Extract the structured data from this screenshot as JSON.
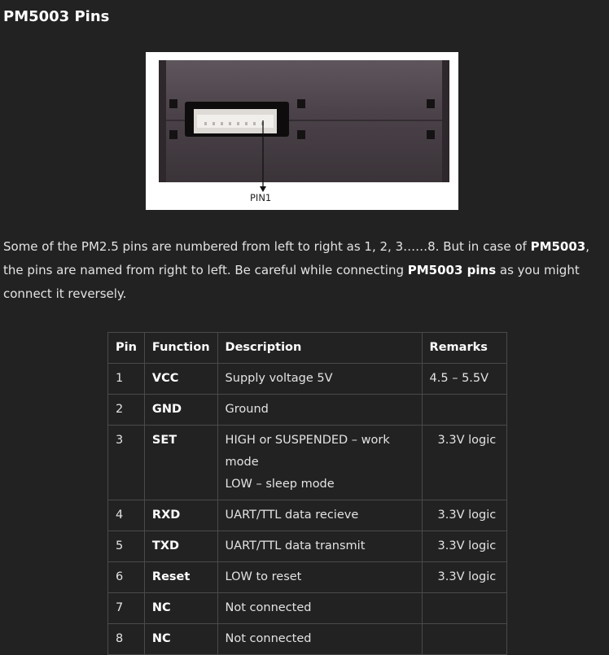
{
  "heading": "PM5003 Pins",
  "figure": {
    "pin_label": "PIN1"
  },
  "paragraph": {
    "t1": "Some of the PM2.5 pins are numbered from left to right as 1, 2, 3……8. But in case of ",
    "b1": "PM5003",
    "t2": ", the pins are named from right to left. Be careful while connecting ",
    "b2": "PM5003 pins",
    "t3": " as you might connect it reversely."
  },
  "table": {
    "headers": [
      "Pin",
      "Function",
      "Description",
      "Remarks"
    ],
    "rows": [
      {
        "pin": "1",
        "function": "VCC",
        "desc1": "Supply voltage 5V",
        "desc2": "",
        "remarks": "4.5 – 5.5V"
      },
      {
        "pin": "2",
        "function": "GND",
        "desc1": "Ground",
        "desc2": "",
        "remarks": ""
      },
      {
        "pin": "3",
        "function": "SET",
        "desc1": "HIGH or SUSPENDED – work mode",
        "desc2": "LOW – sleep mode",
        "remarks": "3.3V logic"
      },
      {
        "pin": "4",
        "function": "RXD",
        "desc1": "UART/TTL data recieve",
        "desc2": "",
        "remarks": "3.3V logic"
      },
      {
        "pin": "5",
        "function": "TXD",
        "desc1": "UART/TTL data transmit",
        "desc2": "",
        "remarks": "3.3V logic"
      },
      {
        "pin": "6",
        "function": "Reset",
        "desc1": "LOW to reset",
        "desc2": "",
        "remarks": "3.3V logic"
      },
      {
        "pin": "7",
        "function": "NC",
        "desc1": "Not connected",
        "desc2": "",
        "remarks": ""
      },
      {
        "pin": "8",
        "function": "NC",
        "desc1": "Not connected",
        "desc2": "",
        "remarks": ""
      }
    ]
  }
}
